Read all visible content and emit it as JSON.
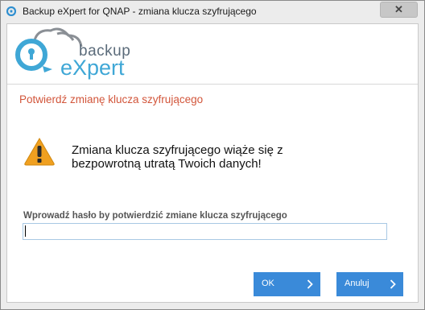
{
  "window": {
    "title": "Backup eXpert for QNAP - zmiana klucza szyfrującego",
    "close_glyph": "✕"
  },
  "logo": {
    "line1": "backup",
    "line2": "eXpert"
  },
  "dialog": {
    "heading": "Potwierdź zmianę klucza szyfrującego",
    "warning_line1": "Zmiana klucza szyfrującego wiąże się z",
    "warning_line2": "bezpowrotną utratą Twoich danych!",
    "password_label": "Wprowadź hasło by potwierdzić zmiane klucza szyfrującego",
    "password_value": ""
  },
  "buttons": {
    "ok": "OK",
    "cancel": "Anuluj"
  },
  "colors": {
    "accent": "#3a8ad9",
    "heading": "#d2553a",
    "warning_icon": "#f0a020",
    "logo_blue": "#3fa7d6"
  },
  "icons": {
    "app": "cloud-lock-icon",
    "warning": "warning-triangle-icon",
    "close": "close-icon",
    "chevron": "chevron-right-icon"
  }
}
